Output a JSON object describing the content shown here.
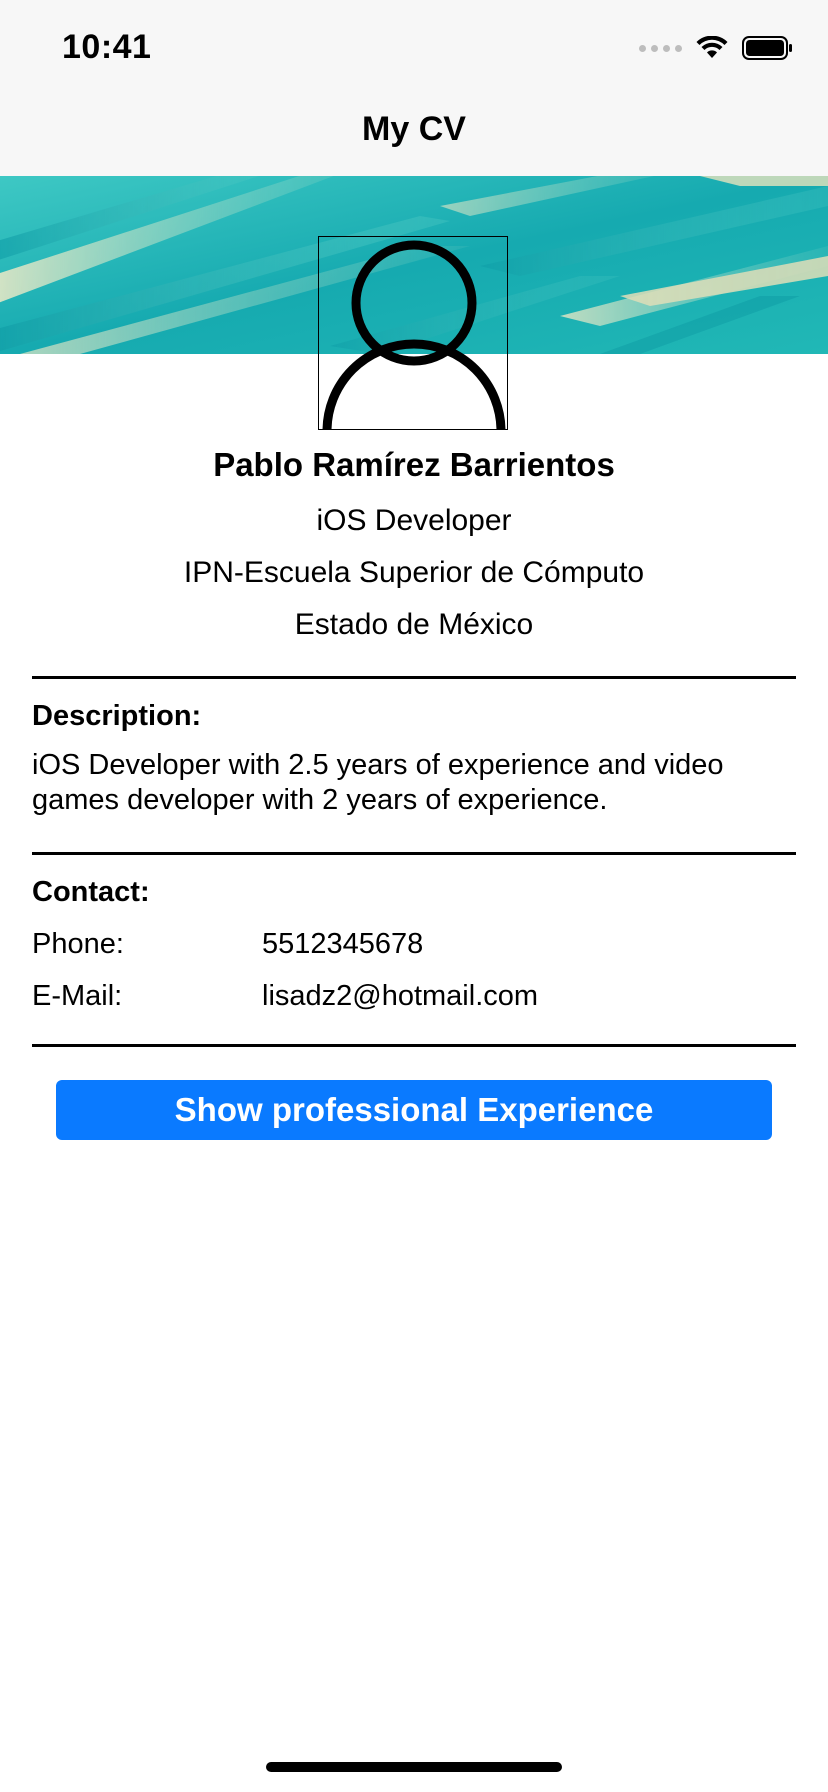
{
  "status_bar": {
    "time": "10:41",
    "icons": [
      "signal-icon",
      "wifi-icon",
      "battery-icon"
    ]
  },
  "nav": {
    "title": "My CV"
  },
  "profile": {
    "avatar_icon": "person-icon",
    "name": "Pablo Ramírez Barrientos",
    "role": "iOS Developer",
    "school": "IPN-Escuela Superior de Cómputo",
    "location": "Estado de México"
  },
  "description": {
    "label": "Description:",
    "text": "iOS Developer with 2.5 years of experience and video games developer with 2 years of experience."
  },
  "contact": {
    "label": "Contact:",
    "rows": [
      {
        "label": "Phone:",
        "value": "5512345678"
      },
      {
        "label": "E-Mail:",
        "value": "lisadz2@hotmail.com"
      }
    ]
  },
  "actions": {
    "experience_button": "Show professional Experience"
  },
  "colors": {
    "accent": "#0a7aff",
    "banner_teal": "#1fb3b5",
    "banner_cream": "#f3e7c0"
  }
}
